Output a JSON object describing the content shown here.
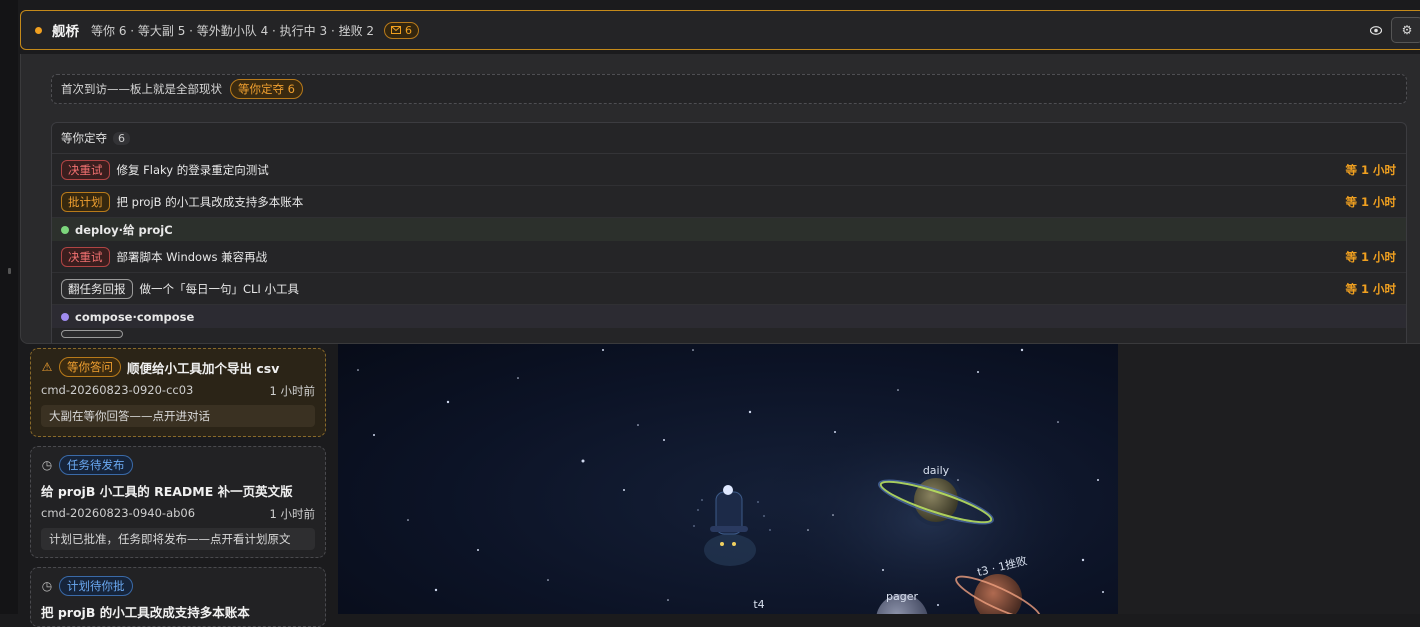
{
  "topbar": {
    "brand": "舰桥",
    "summary": "等你 6 · 等大副 5 · 等外勤小队 4 · 执行中 3 · 挫败 2",
    "mail_count": "6"
  },
  "panel": {
    "first_visit_text": "首次到访——板上就是全部现状",
    "first_visit_pill": "等你定夺 6",
    "waiting_title": "等你定夺",
    "waiting_count": "6",
    "rows": [
      {
        "tag": "决重试",
        "text": "修复 Flaky 的登录重定向测试",
        "wait": "等 1 小时"
      },
      {
        "tag": "批计划",
        "text": "把 projB 的小工具改成支持多本账本",
        "wait": "等 1 小时"
      },
      {
        "group": "deploy·给 projC"
      },
      {
        "tag": "决重试",
        "text": "部署脚本 Windows 兼容再战",
        "wait": "等 1 小时"
      },
      {
        "tag": "翻任务回报",
        "text": "做一个「每日一句」CLI 小工具",
        "wait": "等 1 小时"
      },
      {
        "group": "compose·compose"
      }
    ]
  },
  "cards": [
    {
      "status": "等你答问",
      "title": "顺便给小工具加个导出 csv",
      "id": "cmd-20260823-0920-cc03",
      "time": "1 小时前",
      "note": "大副在等你回答——点开进对话"
    },
    {
      "status": "任务待发布",
      "title": "给 projB 小工具的 README 补一页英文版",
      "id": "cmd-20260823-0940-ab06",
      "time": "1 小时前",
      "note": "计划已批准，任务即将发布——点开看计划原文"
    },
    {
      "status": "计划待你批",
      "title": "把 projB 的小工具改成支持多本账本"
    }
  ],
  "scene": {
    "planets": [
      "daily",
      "t3 · 1挫败",
      "pager",
      "t4"
    ]
  },
  "colors": {
    "accent": "#f0a020",
    "danger": "#f07070",
    "info": "#6aa8f0",
    "group_green": "#7cd67c",
    "group_purple": "#a08cf0"
  }
}
